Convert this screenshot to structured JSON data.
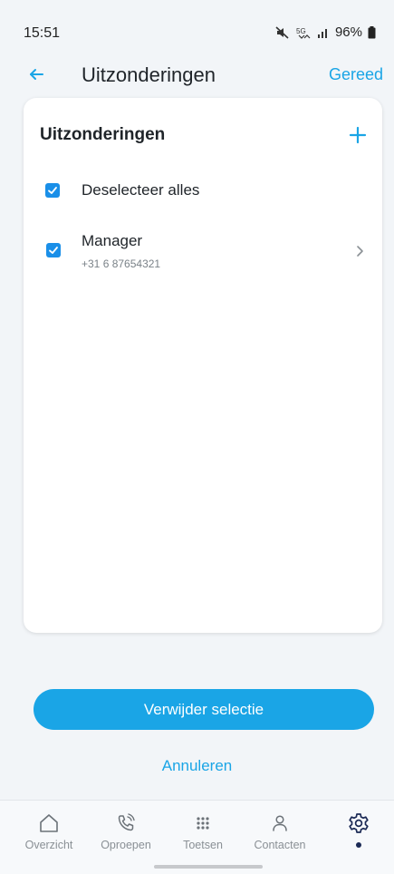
{
  "status_bar": {
    "time": "15:51",
    "network": "5G",
    "battery": "96%"
  },
  "header": {
    "title": "Uitzonderingen",
    "done_label": "Gereed"
  },
  "card": {
    "title": "Uitzonderingen",
    "select_all_label": "Deselecteer alles",
    "items": [
      {
        "name": "Manager",
        "phone": "+31 6 87654321",
        "checked": true
      }
    ]
  },
  "actions": {
    "primary_label": "Verwijder selectie",
    "cancel_label": "Annuleren"
  },
  "nav": {
    "items": [
      {
        "label": "Overzicht",
        "icon": "home-icon"
      },
      {
        "label": "Oproepen",
        "icon": "phone-icon"
      },
      {
        "label": "Toetsen",
        "icon": "dialpad-icon"
      },
      {
        "label": "Contacten",
        "icon": "person-icon"
      },
      {
        "label": "",
        "icon": "gear-icon",
        "active": true
      }
    ]
  },
  "colors": {
    "accent": "#1aa5e6",
    "checkbox": "#1a8fe8",
    "background": "#f2f5f8"
  }
}
